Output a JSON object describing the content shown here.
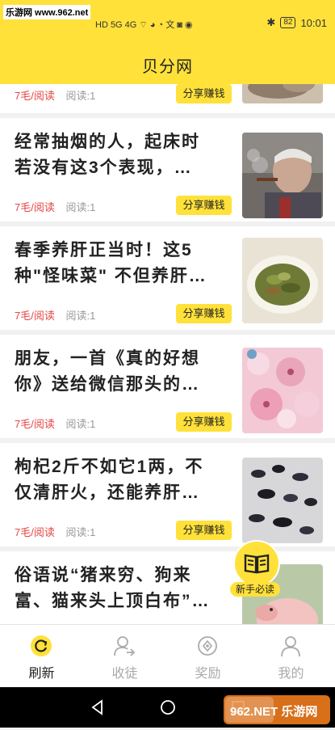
{
  "status_bar": {
    "watermark": "乐游网 www.962.net",
    "icons": "HD 5G 4G ⌔ ◕ ◔ 文 ◙ ◉",
    "battery": "82",
    "time": "10:01"
  },
  "app": {
    "title": "贝分网"
  },
  "feed": {
    "partial_card": {
      "reward": "7毛/阅读",
      "reads": "阅读:1",
      "share_label": "分享赚钱"
    },
    "cards": [
      {
        "title_line1": "经常抽烟的人，起床时",
        "title_line2": "若没有这3个表现，…",
        "reward": "7毛/阅读",
        "reads": "阅读:1",
        "share_label": "分享赚钱",
        "thumb_icon": "smoking-man-image"
      },
      {
        "title_line1": "春季养肝正当时！这5",
        "title_line2": "种\"怪味菜\" 不但养肝…",
        "reward": "7毛/阅读",
        "reads": "阅读:1",
        "share_label": "分享赚钱",
        "thumb_icon": "vegetable-dish-image"
      },
      {
        "title_line1": "朋友，一首《真的好想",
        "title_line2": "你》送给微信那头的…",
        "reward": "7毛/阅读",
        "reads": "阅读:1",
        "share_label": "分享赚钱",
        "thumb_icon": "cherry-blossom-image"
      },
      {
        "title_line1": "枸杞2斤不如它1两，不",
        "title_line2": "仅清肝火，还能养肝…",
        "reward": "7毛/阅读",
        "reads": "阅读:1",
        "share_label": "分享赚钱",
        "thumb_icon": "black-goji-image"
      },
      {
        "title_line1": "俗语说“猪来穷、狗来",
        "title_line2": "富、猫来头上顶白布”…",
        "thumb_icon": "pig-image"
      }
    ]
  },
  "floating_button": {
    "label": "新手必读"
  },
  "tabs": [
    {
      "label": "刷新",
      "icon": "refresh-icon",
      "active": true
    },
    {
      "label": "收徒",
      "icon": "user-add-icon",
      "active": false
    },
    {
      "label": "奖励",
      "icon": "compass-icon",
      "active": false
    },
    {
      "label": "我的",
      "icon": "person-icon",
      "active": false
    }
  ],
  "watermark_br": "962.NET 乐游网",
  "colors": {
    "accent": "#ffe13a",
    "reward": "#e64545",
    "muted": "#999999"
  }
}
